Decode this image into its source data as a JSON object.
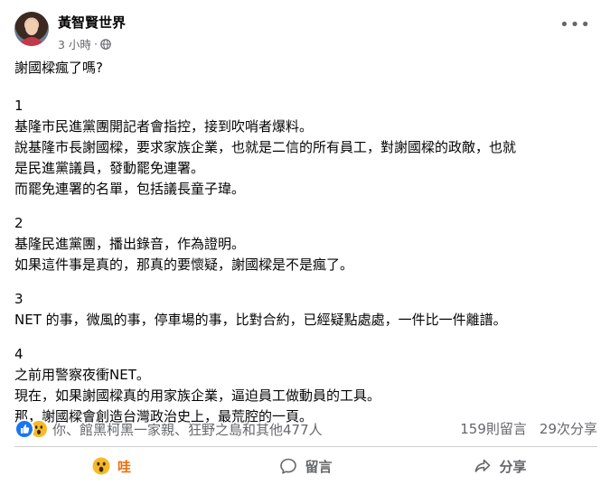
{
  "post": {
    "author": "黃智賢世界",
    "time": "3 小時",
    "separator": "·",
    "lines": [
      "謝國樑瘋了嗎?",
      "",
      "1",
      "基隆市民進黨團開記者會指控，接到吹哨者爆料。",
      "說基隆市長謝國樑，要求家族企業，也就是二信的所有員工，對謝國樑的政敵，也就",
      "是民進黨議員，發動罷免連署。",
      "而罷免連署的名單，包括議長童子瑋。",
      "",
      "2",
      "基隆民進黨團，播出錄音，作為證明。",
      "如果這件事是真的，那真的要懷疑，謝國樑是不是瘋了。",
      "",
      "3",
      "NET 的事，微風的事，停車場的事，比對合約，已經疑點處處，一件比一件離譜。",
      "",
      "4",
      "之前用警察夜衝NET。",
      "現在，如果謝國樑真的用家族企業，逼迫員工做動員的工具。",
      "那，謝國樑會創造台灣政治史上，最荒腔的一頁。"
    ]
  },
  "stats": {
    "reactions_text": "你、館黑柯黑一家親、狂野之島和其他477人",
    "comments": "159則留言",
    "shares": "29次分享"
  },
  "actions": {
    "react_label": "哇",
    "comment_label": "留言",
    "share_label": "分享"
  },
  "colors": {
    "reaction_active": "#e9710f",
    "like_blue": "#1877f2",
    "wow_yellow": "#f7b928",
    "secondary_text": "#65676b"
  },
  "icons": {
    "more": "more-options-icon",
    "privacy": "globe-icon",
    "like": "like-reaction-icon",
    "wow": "wow-reaction-icon",
    "comment": "comment-icon",
    "share": "share-icon"
  }
}
